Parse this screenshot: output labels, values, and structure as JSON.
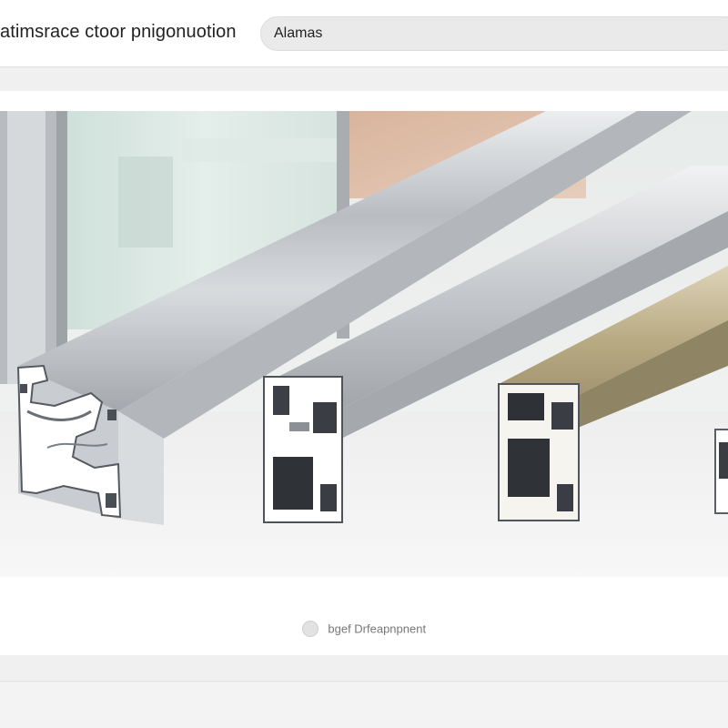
{
  "header": {
    "title": "atimsrace ctoor pnigonuotion",
    "search_value": "Alamas"
  },
  "hero": {
    "subject": "aluminum-profile-extrusions"
  },
  "caption": {
    "text": "bgef Drfeapnpnent",
    "icon": "circle-bullet-icon"
  },
  "colors": {
    "background": "#f0f0f0",
    "panel": "#ffffff",
    "aluminum": "#c3c6ca",
    "champagne": "#b7a982"
  }
}
